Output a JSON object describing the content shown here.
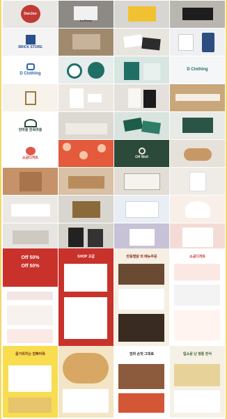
{
  "grid_labels": {
    "danjoo": "DanJoo",
    "lnfresh": "Ln Fresh",
    "brick": "BRICK STORE",
    "dclothing1": "D Clothing",
    "dclothing2": "D Clothing",
    "hanok": "한마을 한옥마을",
    "offwell": "Off Well",
    "dessert": "소공디저트"
  },
  "detail_texts": {
    "banner1": "Off 50%",
    "banner2": "Off 50%",
    "c2_title": "SHOP 고급",
    "c3_title": "안동찜닭 외 메뉴주문",
    "c4_title": "소공디저트",
    "b1_title": "즐거워지는 엄빠어묵",
    "b3_title": "엄마 손맛 그대로",
    "b4_title": "입소문 난 정통 한식"
  },
  "colors": {
    "border": "#f4d86a",
    "red": "#c8322b",
    "teal": "#1f6f66",
    "navy": "#233a6b",
    "green": "#2c4a3a",
    "cream": "#f5efe4"
  }
}
